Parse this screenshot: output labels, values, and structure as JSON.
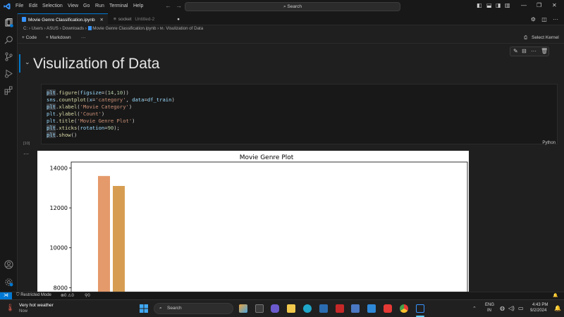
{
  "titlebar": {
    "menus": [
      "File",
      "Edit",
      "Selection",
      "View",
      "Go",
      "Run",
      "Terminal",
      "Help"
    ],
    "search_label": "Search"
  },
  "tabs": [
    {
      "label": "Movie Genre Classification.ipynb",
      "active": true
    },
    {
      "label": "socket",
      "sublabel": "Untitled-2",
      "active": false
    }
  ],
  "breadcrumb": {
    "parts": [
      "C:",
      "Users",
      "ASUS",
      "Downloads",
      "Movie Genre Classification.ipynb",
      "Visulization of Data"
    ],
    "md_prefix": "M↓"
  },
  "notebook_toolbar": {
    "code_label": "+ Code",
    "markdown_label": "+ Markdown",
    "more_label": "···",
    "kernel_label": "Select Kernel"
  },
  "markdown_cell": {
    "heading": "Visulization of Data"
  },
  "code_cell": {
    "lines": [
      "plt.figure(figsize=(14,10))",
      "sns.countplot(x='category', data=df_train)",
      "plt.xlabel('Movie Category')",
      "plt.ylabel('Count')",
      "plt.title('Movie Genre Plot')",
      "plt.xticks(rotation=90);",
      "plt.show()"
    ],
    "execution_count": "[10]",
    "language": "Python",
    "output_menu": "···"
  },
  "chart_data": {
    "type": "bar",
    "title": "Movie Genre Plot",
    "xlabel": "",
    "ylabel": "",
    "yticks": [
      8000,
      10000,
      12000,
      14000
    ],
    "ylim_visible": [
      7800,
      14300
    ],
    "categories": [
      "",
      ""
    ],
    "values": [
      13600,
      13100
    ],
    "colors": [
      "#e59a6b",
      "#d69d52"
    ]
  },
  "statusbar": {
    "restricted_label": "Restricted Mode",
    "errors": "0",
    "warnings": "0",
    "ports": "0"
  },
  "taskbar": {
    "weather_title": "Very hot weather",
    "weather_sub": "Now",
    "search_label": "Search",
    "lang_top": "ENG",
    "lang_bottom": "IN",
    "time": "4:43 PM",
    "date": "9/2/2024"
  },
  "colors": {
    "accent": "#0078d4",
    "editor_bg": "#1f1f1f",
    "chrome_bg": "#181818"
  }
}
